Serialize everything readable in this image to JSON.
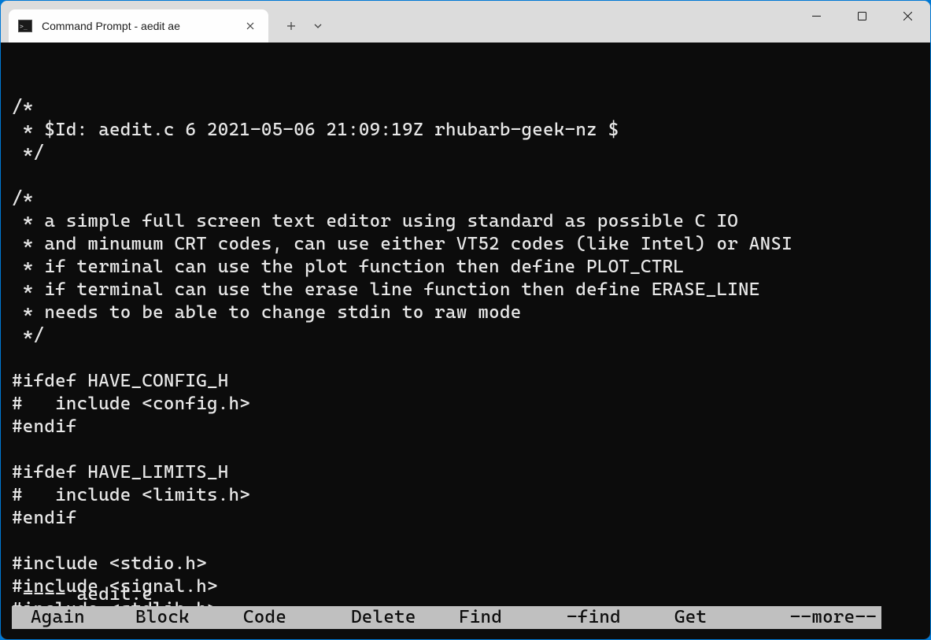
{
  "titlebar": {
    "tab_title": "Command Prompt - aedit  ae"
  },
  "terminal": {
    "lines": [
      "/*",
      " * $Id: aedit.c 6 2021-05-06 21:09:19Z rhubarb-geek-nz $",
      " */",
      "",
      "/*",
      " * a simple full screen text editor using standard as possible C IO",
      " * and minumum CRT codes, can use either VT52 codes (like Intel) or ANSI",
      " * if terminal can use the plot function then define PLOT_CTRL",
      " * if terminal can use the erase line function then define ERASE_LINE",
      " * needs to be able to change stdin to raw mode",
      " */",
      "",
      "#ifdef HAVE_CONFIG_H",
      "#   include <config.h>",
      "#endif",
      "",
      "#ifdef HAVE_LIMITS_H",
      "#   include <limits.h>",
      "#endif",
      "",
      "#include <stdio.h>",
      "#include <signal.h>",
      "#include <stdlib.h>"
    ],
    "status_line": " ---- aedit.c",
    "menu": {
      "items": [
        "Again",
        "Block",
        "Code",
        "Delete",
        "Find",
        "-find",
        "Get"
      ],
      "more": "--more--"
    }
  }
}
